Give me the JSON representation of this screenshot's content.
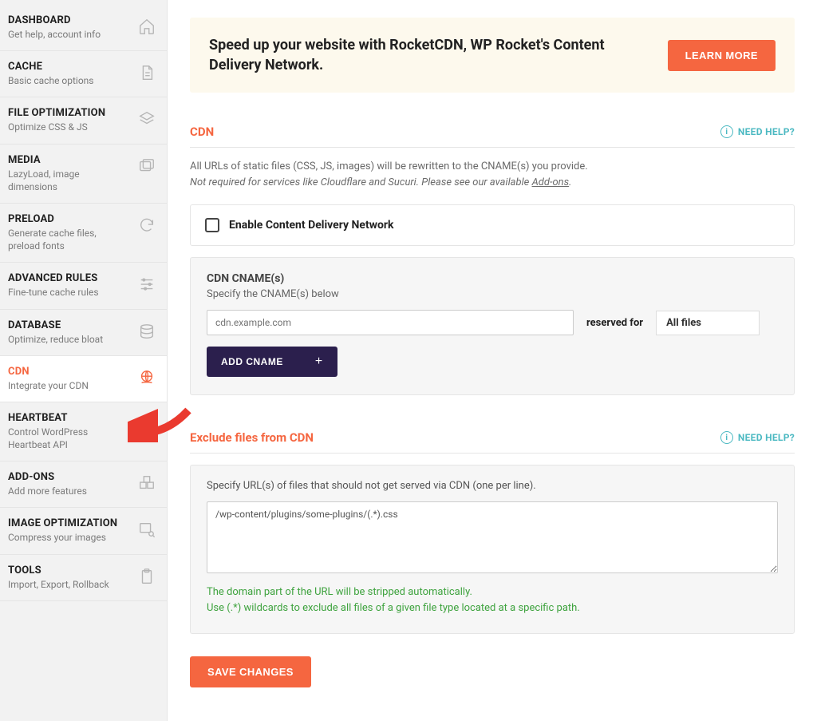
{
  "sidebar": {
    "items": [
      {
        "title": "DASHBOARD",
        "sub": "Get help, account info"
      },
      {
        "title": "CACHE",
        "sub": "Basic cache options"
      },
      {
        "title": "FILE OPTIMIZATION",
        "sub": "Optimize CSS & JS"
      },
      {
        "title": "MEDIA",
        "sub": "LazyLoad, image dimensions"
      },
      {
        "title": "PRELOAD",
        "sub": "Generate cache files, preload fonts"
      },
      {
        "title": "ADVANCED RULES",
        "sub": "Fine-tune cache rules"
      },
      {
        "title": "DATABASE",
        "sub": "Optimize, reduce bloat"
      },
      {
        "title": "CDN",
        "sub": "Integrate your CDN"
      },
      {
        "title": "HEARTBEAT",
        "sub": "Control WordPress Heartbeat API"
      },
      {
        "title": "ADD-ONS",
        "sub": "Add more features"
      },
      {
        "title": "IMAGE OPTIMIZATION",
        "sub": "Compress your images"
      },
      {
        "title": "TOOLS",
        "sub": "Import, Export, Rollback"
      }
    ]
  },
  "promo": {
    "text": "Speed up your website with RocketCDN, WP Rocket's Content Delivery Network.",
    "button": "LEARN MORE"
  },
  "cdn_section": {
    "title": "CDN",
    "need_help": "NEED HELP?",
    "desc_line1": "All URLs of static files (CSS, JS, images) will be rewritten to the CNAME(s) you provide.",
    "desc_line2_pre": "Not required for services like Cloudflare and Sucuri. Please see our available ",
    "desc_line2_link": "Add-ons",
    "desc_line2_post": ".",
    "enable_label": "Enable Content Delivery Network",
    "cnames_label": "CDN CNAME(s)",
    "cnames_sub": "Specify the CNAME(s) below",
    "cname_placeholder": "cdn.example.com",
    "reserved_label": "reserved for",
    "reserved_value": "All files",
    "add_cname": "ADD CNAME"
  },
  "exclude_section": {
    "title": "Exclude files from CDN",
    "need_help": "NEED HELP?",
    "specify": "Specify URL(s) of files that should not get served via CDN (one per line).",
    "textarea_value": "/wp-content/plugins/some-plugins/(.*).css",
    "hint1": "The domain part of the URL will be stripped automatically.",
    "hint2": "Use (.*) wildcards to exclude all files of a given file type located at a specific path."
  },
  "save_label": "SAVE CHANGES"
}
